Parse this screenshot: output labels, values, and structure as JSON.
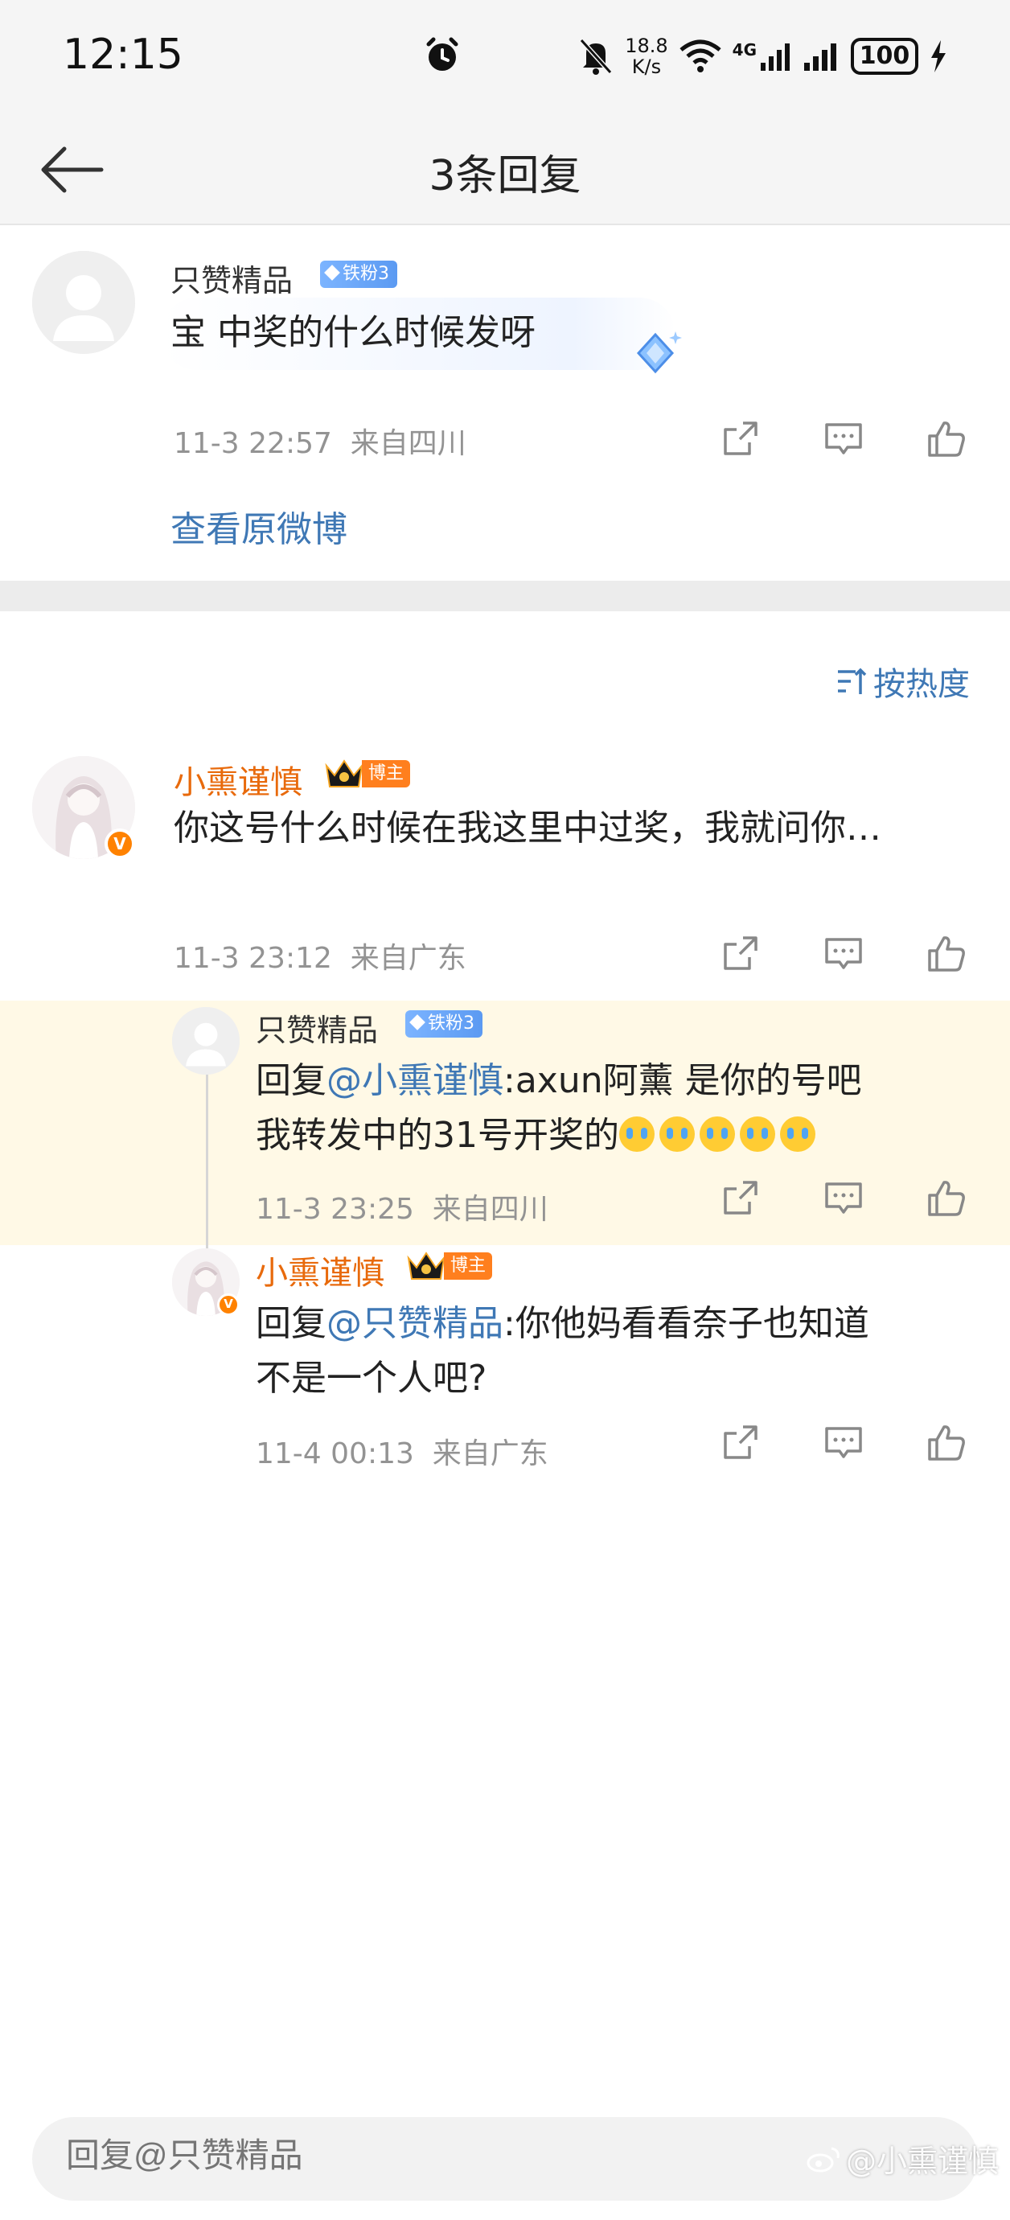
{
  "status_bar": {
    "time": "12:15",
    "net_speed_value": "18.8",
    "net_speed_unit": "K/s",
    "network_type": "4G",
    "battery": "100"
  },
  "header": {
    "title": "3条回复",
    "back_icon": "arrow-left-icon"
  },
  "original_comment": {
    "username": "只赞精品",
    "fan_badge": "铁粉3",
    "text": "宝 中奖的什么时候发呀",
    "time": "11-3 22:57",
    "location": "来自四川",
    "view_original_label": "查看原微博"
  },
  "sort_label": "按热度",
  "replies": [
    {
      "username": "小熏谨慎",
      "badge": "博主",
      "text": "你这号什么时候在我这里中过奖，我就问你…",
      "time": "11-3 23:12",
      "location": "来自广东"
    },
    {
      "username": "只赞精品",
      "fan_badge": "铁粉3",
      "reply_prefix": "回复",
      "mention": "@小熏谨慎",
      "text_line1": ":axun阿薰 是你的号吧",
      "text_line2": "我转发中的31号开奖的",
      "time": "11-3 23:25",
      "location": "来自四川"
    },
    {
      "username": "小熏谨慎",
      "badge": "博主",
      "reply_prefix": "回复",
      "mention": "@只赞精品",
      "text_line1": ":你他妈看看奈子也知道",
      "text_line2": "不是一个人吧?",
      "time": "11-4 00:13",
      "location": "来自广东"
    }
  ],
  "reply_input": {
    "placeholder": "回复@只赞精品"
  },
  "watermark": "@小熏谨慎",
  "colors": {
    "link_blue": "#3f78b5",
    "orange_name": "#e86a0c",
    "highlight_bg": "#fff9e6"
  }
}
